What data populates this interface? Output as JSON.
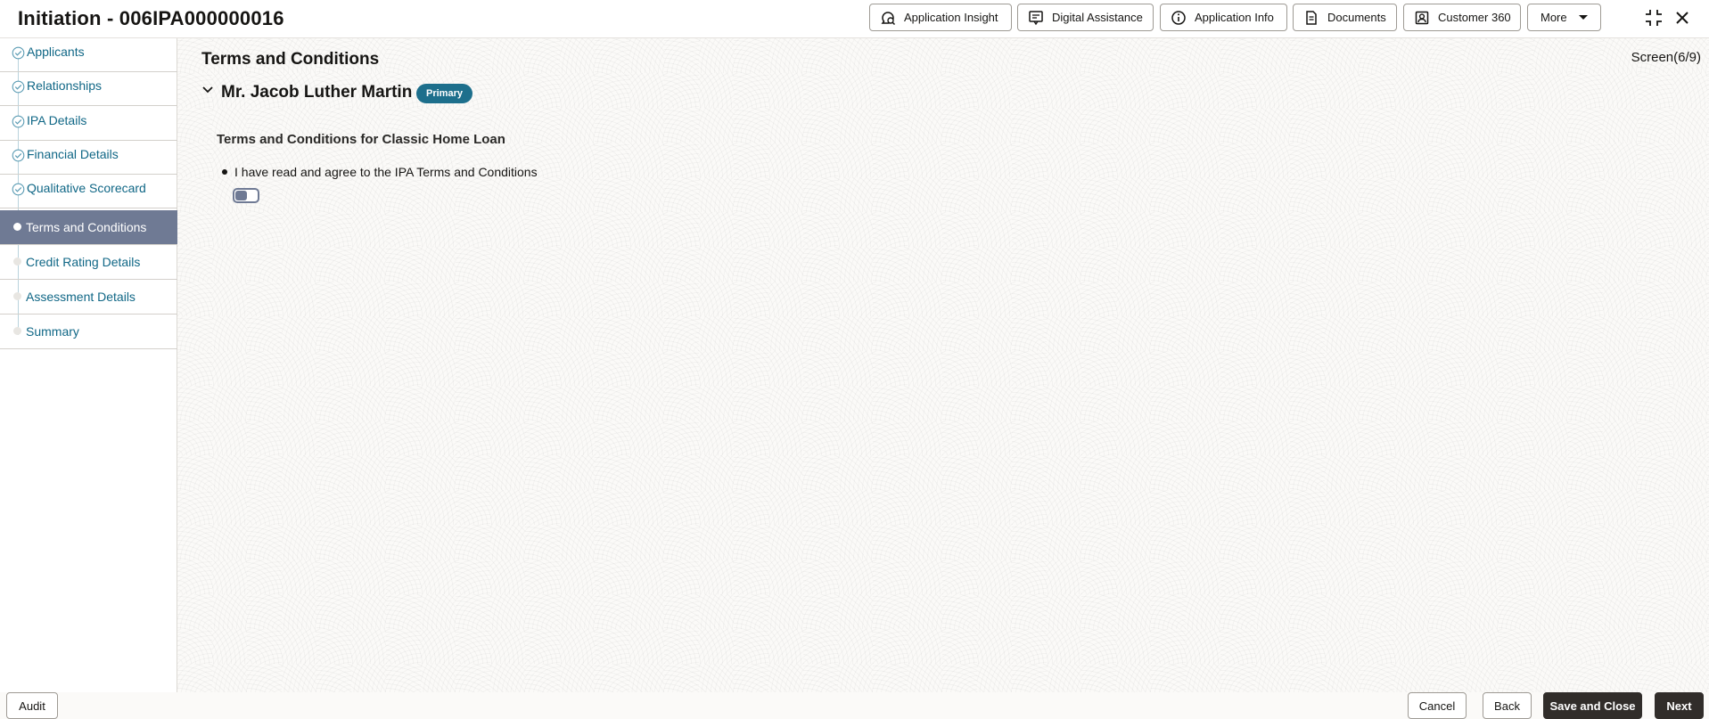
{
  "header": {
    "title": "Initiation - 006IPA000000016",
    "buttons": [
      {
        "label": "Application Insight",
        "icon": "insight-icon"
      },
      {
        "label": "Digital Assistance",
        "icon": "digital-assistance-icon"
      },
      {
        "label": "Application Info",
        "icon": "info-icon"
      },
      {
        "label": "Documents",
        "icon": "documents-icon"
      },
      {
        "label": "Customer 360",
        "icon": "customer-icon"
      },
      {
        "label": "More",
        "icon": "caret-down-icon"
      }
    ]
  },
  "sidebar": {
    "items": [
      {
        "label": "Applicants",
        "state": "done"
      },
      {
        "label": "Relationships",
        "state": "done"
      },
      {
        "label": "IPA Details",
        "state": "done"
      },
      {
        "label": "Financial Details",
        "state": "done"
      },
      {
        "label": "Qualitative Scorecard",
        "state": "done"
      },
      {
        "label": "Terms and Conditions",
        "state": "active"
      },
      {
        "label": "Credit Rating Details",
        "state": "pending"
      },
      {
        "label": "Assessment Details",
        "state": "pending"
      },
      {
        "label": "Summary",
        "state": "pending"
      }
    ]
  },
  "main": {
    "title": "Terms and Conditions",
    "screen_counter": "Screen(6/9)",
    "applicant_name": "Mr. Jacob Luther Martin",
    "applicant_badge": "Primary",
    "section_title": "Terms and Conditions for Classic Home Loan",
    "agreement_text": "I have read and agree to the IPA Terms and Conditions",
    "agreement_toggle_on": false
  },
  "footer": {
    "audit": "Audit",
    "cancel": "Cancel",
    "back": "Back",
    "save_close": "Save and Close",
    "next": "Next"
  },
  "colors": {
    "accent": "#106786",
    "badge": "#1d6f8c",
    "active_nav": "#6f7a94",
    "dark_button": "#312d2a"
  }
}
